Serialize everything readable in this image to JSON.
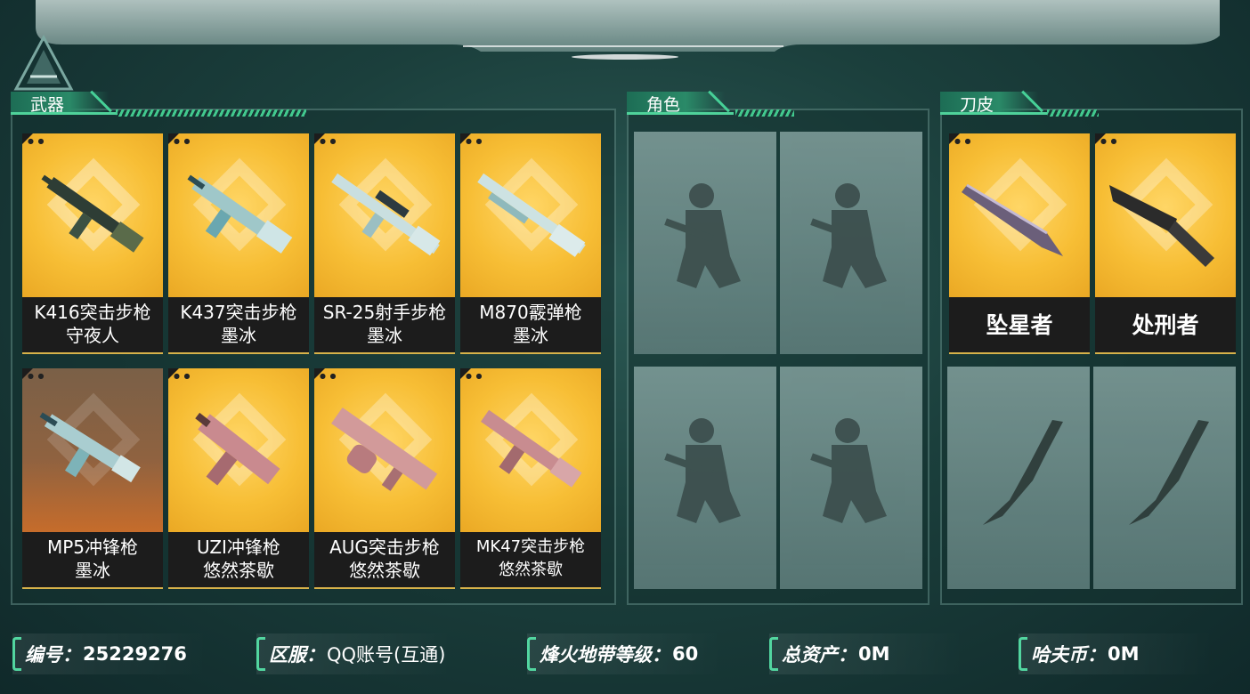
{
  "sections": {
    "weapons": {
      "title": "武器",
      "items": [
        {
          "line1": "K416突击步枪",
          "line2": "守夜人"
        },
        {
          "line1": "K437突击步枪",
          "line2": "墨冰"
        },
        {
          "line1": "SR-25射手步枪",
          "line2": "墨冰"
        },
        {
          "line1": "M870霰弹枪",
          "line2": "墨冰"
        },
        {
          "line1": "MP5冲锋枪",
          "line2": "墨冰"
        },
        {
          "line1": "UZI冲锋枪",
          "line2": "悠然茶歇"
        },
        {
          "line1": "AUG突击步枪",
          "line2": "悠然茶歇"
        },
        {
          "line1": "MK47突击步枪",
          "line2": "悠然茶歇"
        }
      ]
    },
    "characters": {
      "title": "角色"
    },
    "knives": {
      "title": "刀皮",
      "items": [
        {
          "name": "坠星者"
        },
        {
          "name": "处刑者"
        }
      ]
    }
  },
  "footer": {
    "id_label": "编号：",
    "id_value": "25229276",
    "server_label": "区服：",
    "server_value": "QQ账号(互通)",
    "level_label": "烽火地带等级：",
    "level_value": "60",
    "assets_label": "总资产：",
    "assets_value": "0M",
    "currency_label": "哈夫币：",
    "currency_value": "0M"
  },
  "colors": {
    "accent": "#4fd29a",
    "card_gold": "#f7be35",
    "card_brown": "#8f6240",
    "background": "#1b3f3c"
  }
}
